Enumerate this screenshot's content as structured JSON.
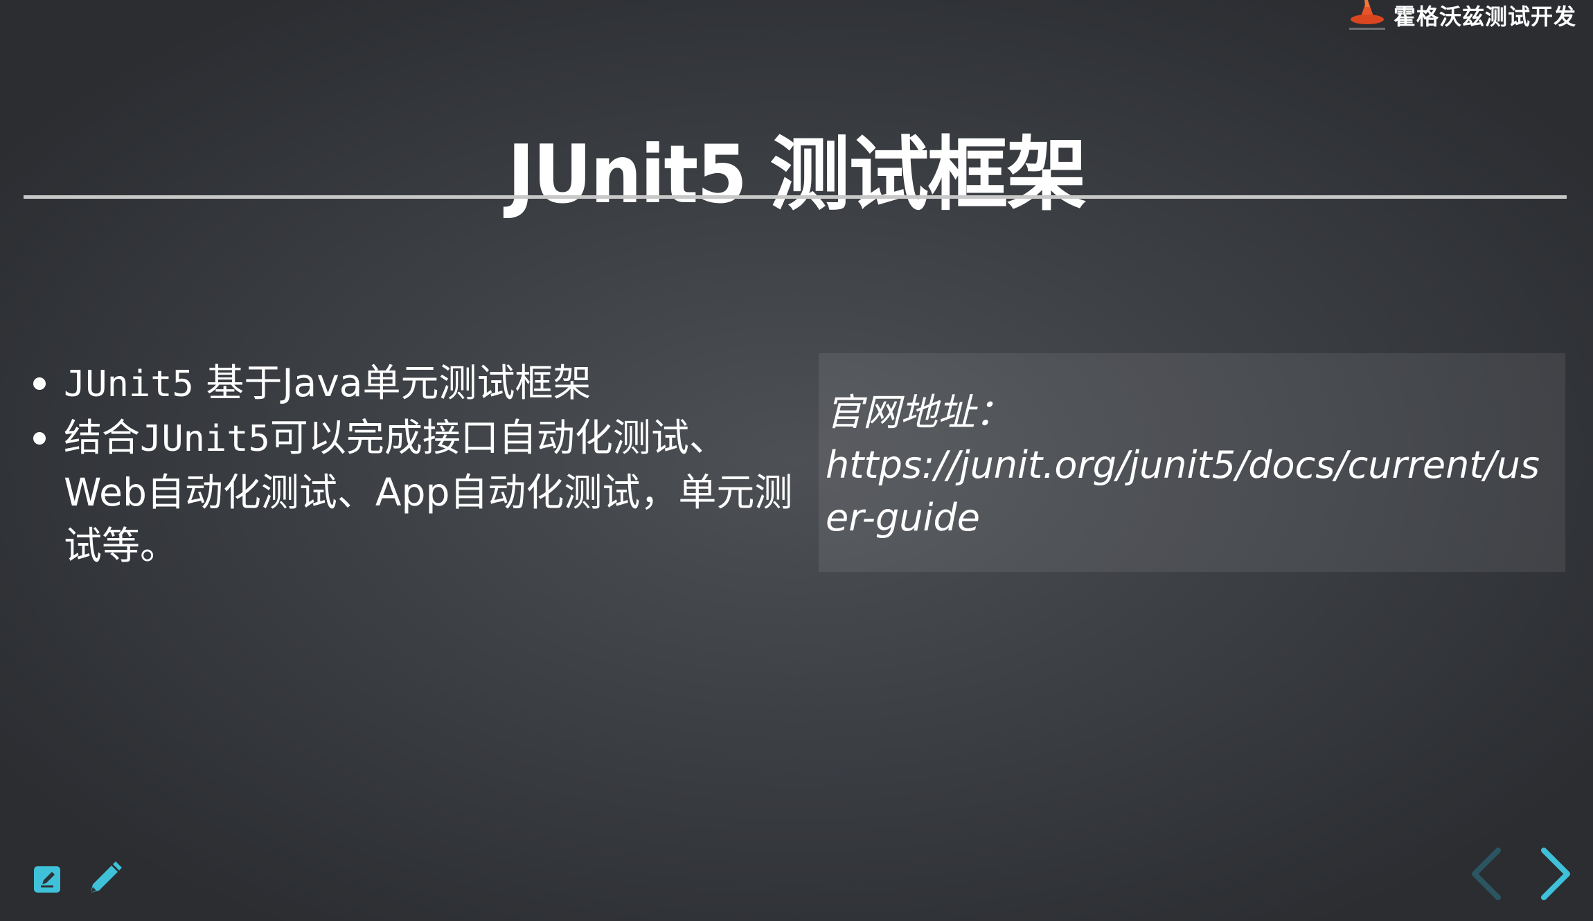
{
  "brand": {
    "name": "霍格沃兹测试开发",
    "logo_icon": "wizard-hat-icon",
    "accent_color": "#e8542a"
  },
  "slide": {
    "title": "JUnit5 测试框架",
    "bullets": [
      {
        "code": "JUnit5",
        "text": " 基于Java单元测试框架"
      },
      {
        "pre": "结合",
        "code": "JUnit5",
        "text": "可以完成接口自动化测试、Web自动化测试、App自动化测试，单元测试等。"
      }
    ],
    "quote": {
      "label": "官网地址：",
      "url": "https://junit.org/junit5/docs/current/user-guide"
    }
  },
  "controls": {
    "edit_icon": "edit-box-icon",
    "pencil_icon": "pencil-icon",
    "prev_icon": "chevron-left-icon",
    "next_icon": "chevron-right-icon",
    "control_color": "#3fc1d9",
    "prev_disabled_color": "#2b5560"
  }
}
